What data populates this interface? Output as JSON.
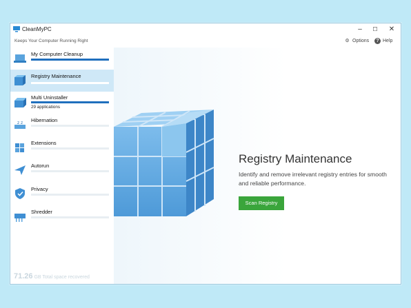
{
  "window": {
    "title": "CleanMyPC",
    "subtitle": "Keeps Your Computer Running Right",
    "controls": {
      "minimize": "–",
      "maximize": "☐",
      "close": "✕"
    }
  },
  "topbar": {
    "options_label": "Options",
    "help_label": "Help"
  },
  "sidebar": {
    "items": [
      {
        "label": "My Computer Cleanup",
        "progress": 1.0,
        "icon": "laptop-icon"
      },
      {
        "label": "Registry Maintenance",
        "progress": 1.0,
        "icon": "registry-cube-icon",
        "active": true
      },
      {
        "label": "Multi Uninstaller",
        "sub": "29 applications",
        "progress": 1.0,
        "icon": "box-icon"
      },
      {
        "label": "Hibernation",
        "icon": "hibernation-icon"
      },
      {
        "label": "Extensions",
        "icon": "puzzle-icon"
      },
      {
        "label": "Autorun",
        "icon": "autorun-arrow-icon"
      },
      {
        "label": "Privacy",
        "icon": "shield-icon"
      },
      {
        "label": "Shredder",
        "icon": "shredder-icon"
      }
    ]
  },
  "footer": {
    "value": "71.26",
    "unit_text": "GB Total space recovered"
  },
  "main": {
    "heading": "Registry Maintenance",
    "description": "Identify and remove irrelevant registry entries for smooth and reliable performance.",
    "scan_button": "Scan Registry"
  },
  "colors": {
    "accent": "#1f6fbd",
    "active_bg": "#cfe8f7",
    "button_green": "#3aa53b",
    "cube_blue": "#6fb1e6"
  }
}
